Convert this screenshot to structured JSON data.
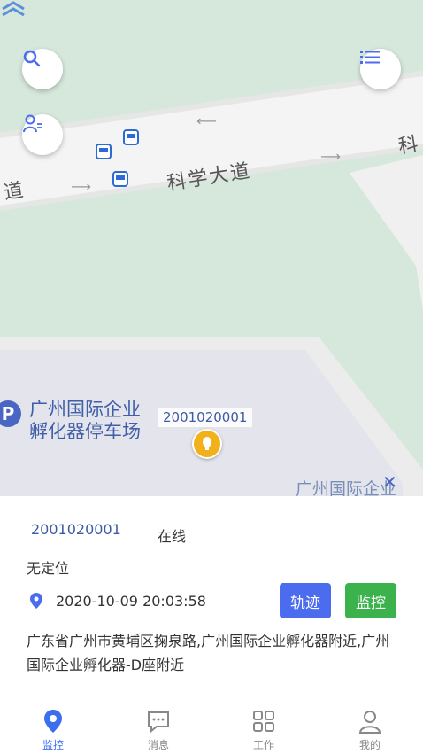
{
  "map": {
    "road_name": "科学大道",
    "road_left_fragment": "道",
    "road_right_fragment": "科",
    "poi_name_line1": "广州国际企业",
    "poi_name_line2": "孵化器停车场",
    "poi_letter": "P",
    "poi_bottom_label": "广州国际企业",
    "device_tag": "2001020001"
  },
  "controls": {
    "search_icon": "search-icon",
    "list_icon": "list-icon",
    "user_switch_icon": "user-switch-icon"
  },
  "device": {
    "id": "2001020001",
    "status": "在线",
    "location_state": "无定位",
    "timestamp": "2020-10-09 20:03:58",
    "address": "广东省广州市黄埔区掬泉路,广州国际企业孵化器附近,广州国际企业孵化器-D座附近"
  },
  "actions": {
    "track_label": "轨迹",
    "monitor_label": "监控"
  },
  "tabs": [
    {
      "label": "监控",
      "icon": "location-pin-icon",
      "active": true
    },
    {
      "label": "消息",
      "icon": "message-icon",
      "active": false
    },
    {
      "label": "工作",
      "icon": "grid-icon",
      "active": false
    },
    {
      "label": "我的",
      "icon": "user-icon",
      "active": false
    }
  ],
  "colors": {
    "accent_blue": "#4c6cf0",
    "accent_green": "#3bb24c",
    "map_green": "#d6e8dc",
    "marker_yellow": "#f2b11b"
  }
}
